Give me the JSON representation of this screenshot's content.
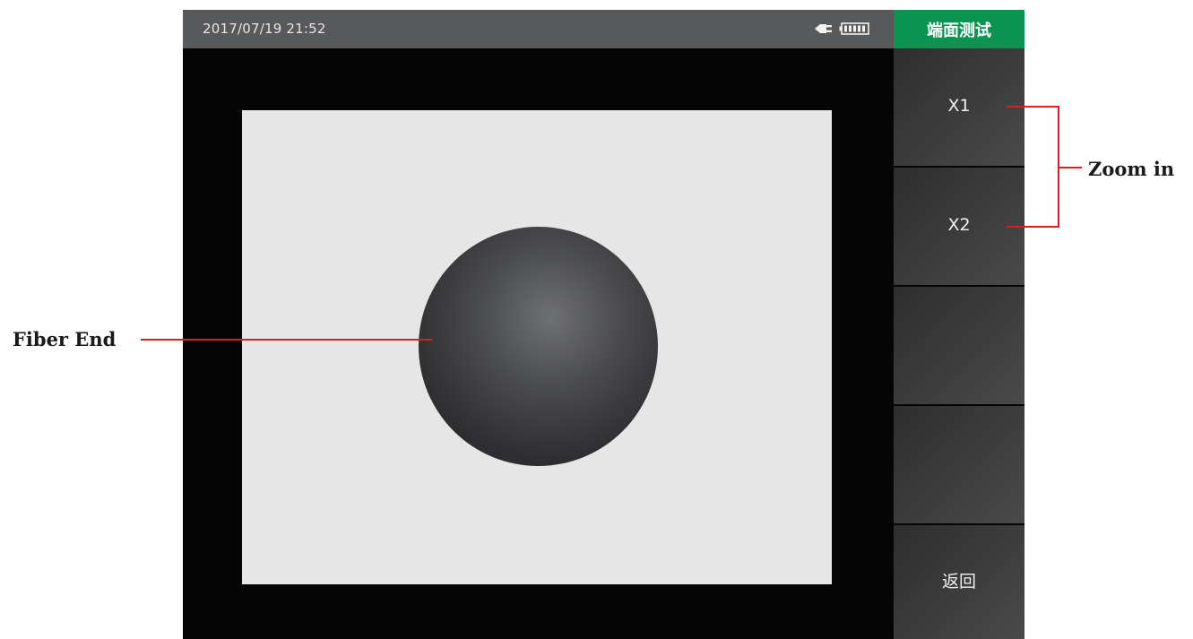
{
  "statusbar": {
    "datetime": "2017/07/19 21:52",
    "icons": [
      "plug-icon",
      "battery-icon"
    ]
  },
  "mode_title": "端面测试",
  "sidebar": {
    "buttons": [
      {
        "label": "X1"
      },
      {
        "label": "X2"
      },
      {
        "label": ""
      },
      {
        "label": ""
      },
      {
        "label": "返回"
      }
    ]
  },
  "annotations": {
    "fiber_end": "Fiber End",
    "zoom_in": "Zoom in"
  },
  "colors": {
    "accent_green": "#0b9450",
    "callout_red": "#d71f26",
    "statusbar": "#58595b",
    "image_bg": "#e6e6e6"
  }
}
